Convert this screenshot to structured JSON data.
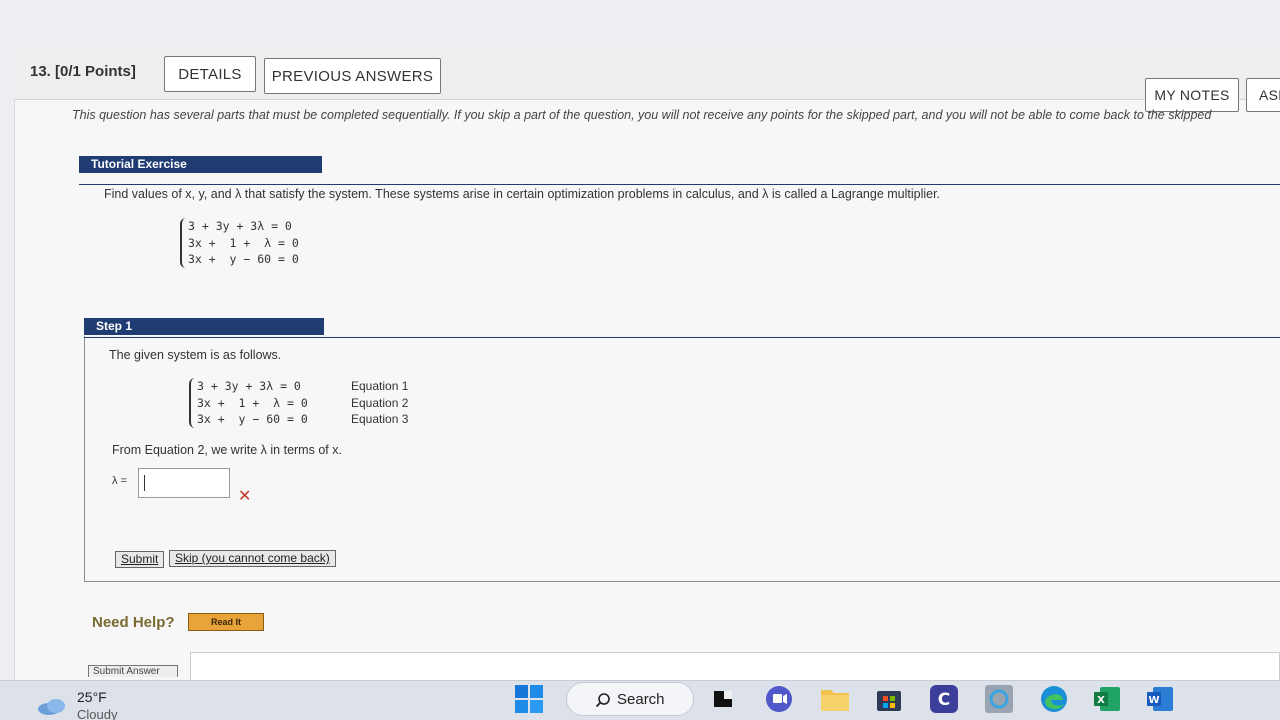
{
  "question": {
    "number_label": "13. [0/1 Points]",
    "details_button": "DETAILS",
    "previous_answers_button": "PREVIOUS ANSWERS",
    "my_notes_button": "MY NOTES",
    "ask_button": "ASK",
    "intro": "This question has several parts that must be completed sequentially. If you skip a part of the question, you will not receive any points for the skipped part, and you will not be able to come back to the skipped"
  },
  "tutorial": {
    "header": "Tutorial Exercise",
    "prompt": "Find values of x, y, and λ that satisfy the system. These systems arise in certain optimization problems in calculus, and λ is called a Lagrange multiplier.",
    "system": [
      "3 + 3y + 3λ = 0",
      "3x +  1 +  λ = 0",
      "3x +  y − 60 = 0"
    ]
  },
  "step": {
    "header": "Step 1",
    "intro": "The given system is as follows.",
    "system": [
      "3 + 3y + 3λ = 0",
      "3x +  1 +  λ = 0",
      "3x +  y − 60 = 0"
    ],
    "labels": [
      "Equation 1",
      "Equation 2",
      "Equation 3"
    ],
    "instruction": "From Equation 2, we write λ in terms of x.",
    "answer_label": "λ =",
    "answer_value": "",
    "submit_label": "Submit",
    "skip_label": "Skip (you cannot come back)"
  },
  "help": {
    "need_help": "Need Help?",
    "read_it": "Read It",
    "submit_answer": "Submit Answer"
  },
  "taskbar": {
    "temperature": "25°F",
    "weather": "Cloudy",
    "search_label": "Search"
  },
  "colors": {
    "header_bar": "#1f3c73",
    "error": "#c0392b",
    "read_it_bg": "#e8a33a"
  }
}
